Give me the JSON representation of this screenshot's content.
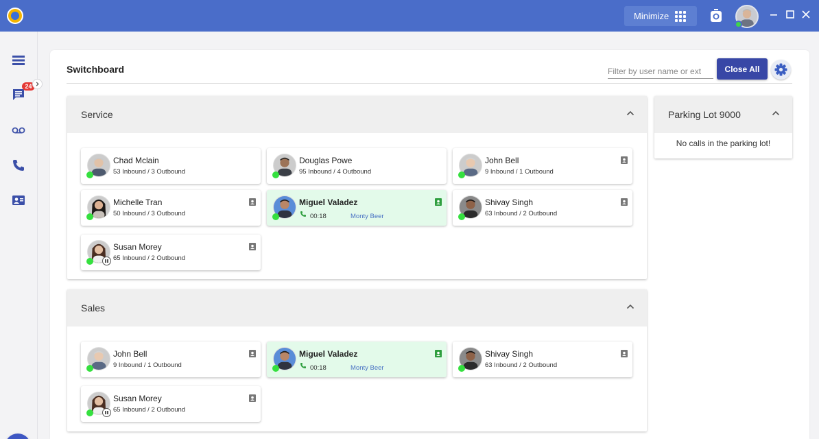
{
  "titlebar": {
    "minimize_label": "Minimize",
    "accent_color": "#4a6dc9"
  },
  "rail": {
    "items": [
      {
        "icon": "menu-icon"
      },
      {
        "icon": "chat-icon",
        "badge": "24"
      },
      {
        "icon": "voicemail-icon"
      },
      {
        "icon": "phone-icon"
      },
      {
        "icon": "contact-card-icon"
      }
    ],
    "fab_icon": "phone-transfer-icon"
  },
  "switchboard": {
    "title": "Switchboard",
    "filter_placeholder": "Filter by user name or ext",
    "close_all_label": "Close All",
    "button_color": "#3847a6"
  },
  "groups": [
    {
      "name": "Service",
      "agents": [
        {
          "name": "Chad Mclain",
          "stats": "53 Inbound / 3 Outbound",
          "status": "available",
          "contact_icon": false
        },
        {
          "name": "Douglas Powe",
          "stats": "95 Inbound / 4 Outbound",
          "status": "available",
          "contact_icon": false
        },
        {
          "name": "John Bell",
          "stats": "9 Inbound / 1 Outbound",
          "status": "available",
          "contact_icon": true
        },
        {
          "name": "Michelle Tran",
          "stats": "50 Inbound / 3 Outbound",
          "status": "available",
          "contact_icon": true
        },
        {
          "name": "Miguel Valadez",
          "status": "on-call",
          "duration": "00:18",
          "caller": "Monty Beer",
          "contact_icon": true
        },
        {
          "name": "Shivay Singh",
          "stats": "63 Inbound / 2 Outbound",
          "status": "available",
          "contact_icon": true
        },
        {
          "name": "Susan Morey",
          "stats": "65 Inbound / 2 Outbound",
          "status": "paused",
          "contact_icon": true
        }
      ]
    },
    {
      "name": "Sales",
      "agents": [
        {
          "name": "John Bell",
          "stats": "9 Inbound / 1 Outbound",
          "status": "available",
          "contact_icon": true
        },
        {
          "name": "Miguel Valadez",
          "status": "on-call",
          "duration": "00:18",
          "caller": "Monty Beer",
          "contact_icon": true
        },
        {
          "name": "Shivay Singh",
          "stats": "63 Inbound / 2 Outbound",
          "status": "available",
          "contact_icon": true
        },
        {
          "name": "Susan Morey",
          "stats": "65 Inbound / 2 Outbound",
          "status": "paused",
          "contact_icon": true
        }
      ]
    }
  ],
  "parking_lot": {
    "title": "Parking Lot 9000",
    "empty_message": "No calls in the parking lot!"
  },
  "colors": {
    "available": "#35e03f",
    "on_call_background": "#e3faea",
    "caller_text": "#4a73c4"
  }
}
